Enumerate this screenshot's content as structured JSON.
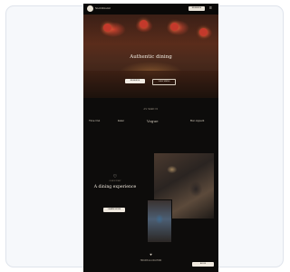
{
  "site": {
    "brand": "SHANGHAI",
    "nav": {
      "cta_label": "RESERVE",
      "menu_icon": "hamburger-icon"
    },
    "hero": {
      "title": "Authentic dining",
      "primary_button": "RESERVE",
      "secondary_button": "VIEW MENU"
    },
    "press": {
      "heading": "AS SEEN IN",
      "logos": [
        "Time Out",
        "Eater",
        "Vogue",
        "Bon Appetit"
      ]
    },
    "about": {
      "eyebrow": "OUR STORY",
      "title": "A dining experience",
      "button": "LEARN MORE"
    },
    "footer": {
      "text": "HOURS & LOCATION",
      "button": "BOOK"
    }
  }
}
